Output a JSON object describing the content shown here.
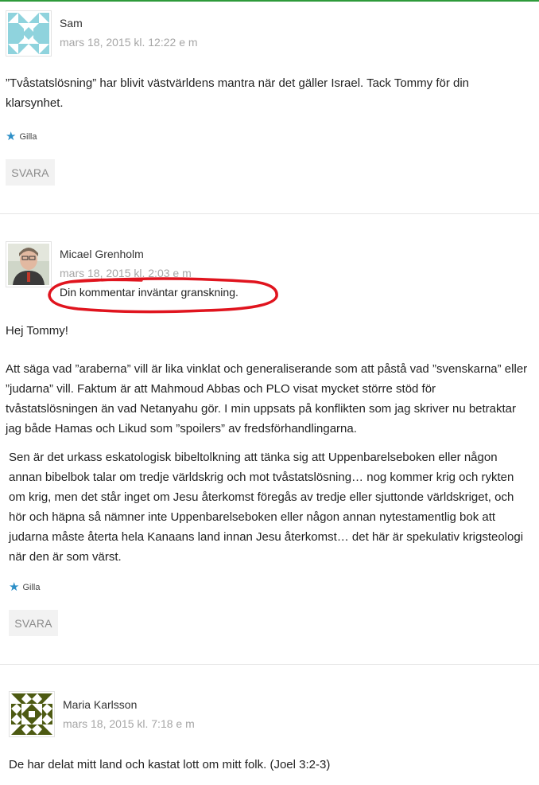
{
  "comments": [
    {
      "author": "Sam",
      "date": "mars 18, 2015 kl. 12:22 e m",
      "paragraphs": [
        "”Tvåstatslösning” har blivit västvärldens mantra när det gäller Israel. Tack Tommy för din klarsynhet."
      ],
      "like_label": "Gilla",
      "reply_label": "SVARA",
      "avatar_icon": "identicon-teal"
    },
    {
      "author": "Micael Grenholm",
      "date": "mars 18, 2015 kl. 2:03 e m",
      "moderation_notice": "Din kommentar inväntar granskning.",
      "paragraphs": [
        "Hej Tommy!",
        "Att säga vad ”araberna” vill är lika vinklat och generaliserande som att påstå vad ”svenskarna” eller ”judarna” vill. Faktum är att Mahmoud Abbas och PLO visat mycket större stöd för tvåstatslösningen än vad Netanyahu gör. I min uppsats på konflikten som jag skriver nu betraktar jag både Hamas och Likud som ”spoilers” av fredsförhandlingarna.",
        "Sen är det urkass eskatologisk bibeltolkning att tänka sig att Uppenbarelseboken eller någon annan bibelbok talar om tredje världskrig och mot tvåstatslösning… nog kommer krig och rykten om krig, men det står inget om Jesu återkomst föregås av tredje eller sjuttonde världskriget, och hör och häpna så nämner inte Uppenbarelseboken eller någon annan nytestamentlig bok att judarna måste återta hela Kanaans land innan Jesu återkomst… det här är spekulativ krigsteologi när den är som värst."
      ],
      "like_label": "Gilla",
      "reply_label": "SVARA",
      "avatar_icon": "user-photo"
    },
    {
      "author": "Maria Karlsson",
      "date": "mars 18, 2015 kl. 7:18 e m",
      "paragraphs": [
        "De har delat mitt land och kastat lott om mitt folk. (Joel 3:2-3)"
      ],
      "avatar_icon": "identicon-olive"
    }
  ],
  "colors": {
    "accent_top": "#2e9a3a",
    "star": "#2d8fc7",
    "highlight_circle": "#e0141e",
    "teal_identicon": "#8fd3dd",
    "olive_identicon": "#4d5a12"
  }
}
